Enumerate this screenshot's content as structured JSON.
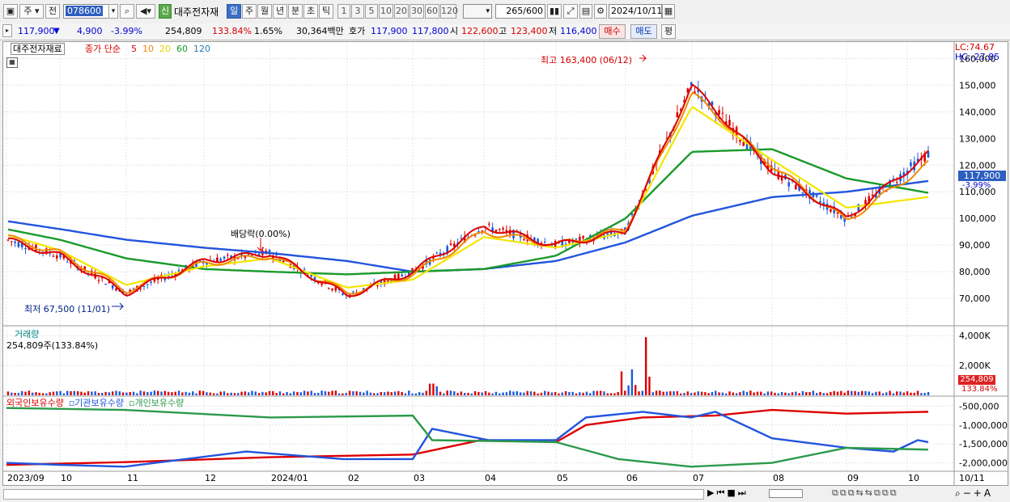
{
  "toolbar": {
    "period_mode": "주",
    "prev_label": "전",
    "stock_code": "078600",
    "shin_badge": "신",
    "stock_name": "대주전자재",
    "timeframes": [
      "일",
      "주",
      "월",
      "년",
      "분",
      "초",
      "틱"
    ],
    "timeframe_selected": "일",
    "intervals": [
      "1",
      "3",
      "5",
      "10",
      "20",
      "30",
      "60",
      "120"
    ],
    "count_value": "265",
    "count_total": "/600",
    "date": "2024/10/11"
  },
  "quote": {
    "price": "117,900",
    "change": "4,900",
    "change_pct": "-3.99%",
    "volume": "254,809",
    "volume_ratio": "133.84%",
    "turnover_rate": "1.65%",
    "trade_value": "30,364백만",
    "hoga_label": "호가",
    "ask": "117,900",
    "bid": "117,800",
    "open_label": "시",
    "open": "122,600",
    "high_label": "고",
    "high": "123,400",
    "low_label": "저",
    "low": "116,400",
    "buy_label": "매수",
    "sell_label": "매도",
    "avg_label": "평"
  },
  "price_panel": {
    "name_tag": "대주전자재료",
    "ma_label": "종가 단순",
    "ma_periods": [
      "5",
      "10",
      "20",
      "60",
      "120"
    ],
    "lc": "LC:74.67",
    "hc": "HC:-27.85",
    "max_label": "최고 163,400 (06/12)",
    "min_label": "최저 67,500 (11/01)",
    "dividend_label": "배당락(0.00%)",
    "y_ticks": [
      "160,000",
      "150,000",
      "140,000",
      "130,000",
      "120,000",
      "110,000",
      "100,000",
      "90,000",
      "80,000",
      "70,000"
    ],
    "current_price": "117,900",
    "current_pct": "-3.99%"
  },
  "volume_panel": {
    "title": "거래량",
    "summary": "254,809주(133.84%)",
    "y_ticks": [
      "4,000K",
      "2,000K"
    ],
    "current": "254,809",
    "current_pct": "133.84%"
  },
  "holding_panel": {
    "series_labels": [
      "외국인보유수량",
      "기관보유수량",
      "개인보유수량"
    ],
    "y_ticks": [
      "-500,000",
      "-1,000,000",
      "-1,500,000",
      "-2,000,000"
    ]
  },
  "x_axis": [
    "2023/09",
    "10",
    "11",
    "12",
    "2024/01",
    "02",
    "03",
    "04",
    "05",
    "06",
    "07",
    "08",
    "09",
    "10",
    "10/11"
  ],
  "colors": {
    "ma5": "#dd0000",
    "ma10": "#f08a00",
    "ma20": "#f2e600",
    "ma60": "#1a9a2a",
    "ma120": "#2255dd",
    "up": "#dd0000",
    "down": "#1e5ad8",
    "foreign": "#dd0000",
    "institution": "#2255dd",
    "individual": "#2a9a4a"
  },
  "chart_data": {
    "type": "line",
    "ma_periods": [
      5,
      10,
      20,
      60,
      120
    ],
    "x": [
      "2023/09",
      "10",
      "11",
      "12",
      "2024/01",
      "02",
      "03",
      "04",
      "05",
      "06",
      "07",
      "08",
      "09",
      "10"
    ],
    "series": [
      {
        "name": "5",
        "values": [
          92000,
          86000,
          72000,
          84000,
          87000,
          71000,
          80000,
          97000,
          90000,
          95000,
          150000,
          118000,
          100000,
          118000
        ]
      },
      {
        "name": "10",
        "values": [
          93000,
          87000,
          73000,
          83000,
          86000,
          72000,
          79000,
          95000,
          90000,
          96000,
          147000,
          120000,
          99000,
          115000
        ]
      },
      {
        "name": "20",
        "values": [
          94000,
          88000,
          75000,
          82000,
          85000,
          74000,
          77000,
          93000,
          89000,
          95000,
          142000,
          122000,
          104000,
          107000
        ]
      },
      {
        "name": "60",
        "values": [
          96000,
          92000,
          85000,
          81000,
          80000,
          79000,
          80000,
          81000,
          86000,
          100000,
          125000,
          126000,
          115000,
          111000
        ]
      },
      {
        "name": "120",
        "values": [
          99000,
          96000,
          92000,
          89000,
          87000,
          84000,
          80000,
          81000,
          84000,
          91000,
          101000,
          108000,
          110000,
          113000
        ]
      }
    ],
    "ylim": [
      60000,
      165000
    ]
  }
}
